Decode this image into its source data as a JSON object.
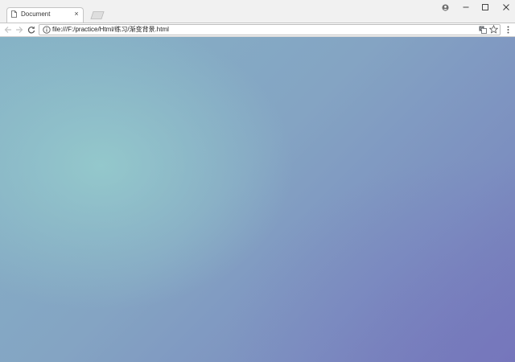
{
  "browser": {
    "tab": {
      "title": "Document",
      "close_glyph": "×",
      "icon": "document-icon"
    },
    "window_controls": {
      "profile_icon": "profile-icon",
      "minimize_icon": "minimize-icon",
      "maximize_icon": "maximize-icon",
      "close_icon": "close-icon"
    },
    "toolbar": {
      "back_icon": "back-arrow-icon",
      "forward_icon": "forward-arrow-icon",
      "reload_icon": "reload-icon",
      "menu_icon": "more-vertical-icon"
    },
    "omnibox": {
      "url": "file:///F:/practice/Html/练习/渐变背景.html",
      "security_icon": "info-icon",
      "translate_icon": "translate-icon",
      "bookmark_icon": "star-icon"
    }
  },
  "page": {
    "background_colors": {
      "highlight": "#96cdcd",
      "mid": "#84a4c3",
      "end": "#7476b8"
    }
  }
}
